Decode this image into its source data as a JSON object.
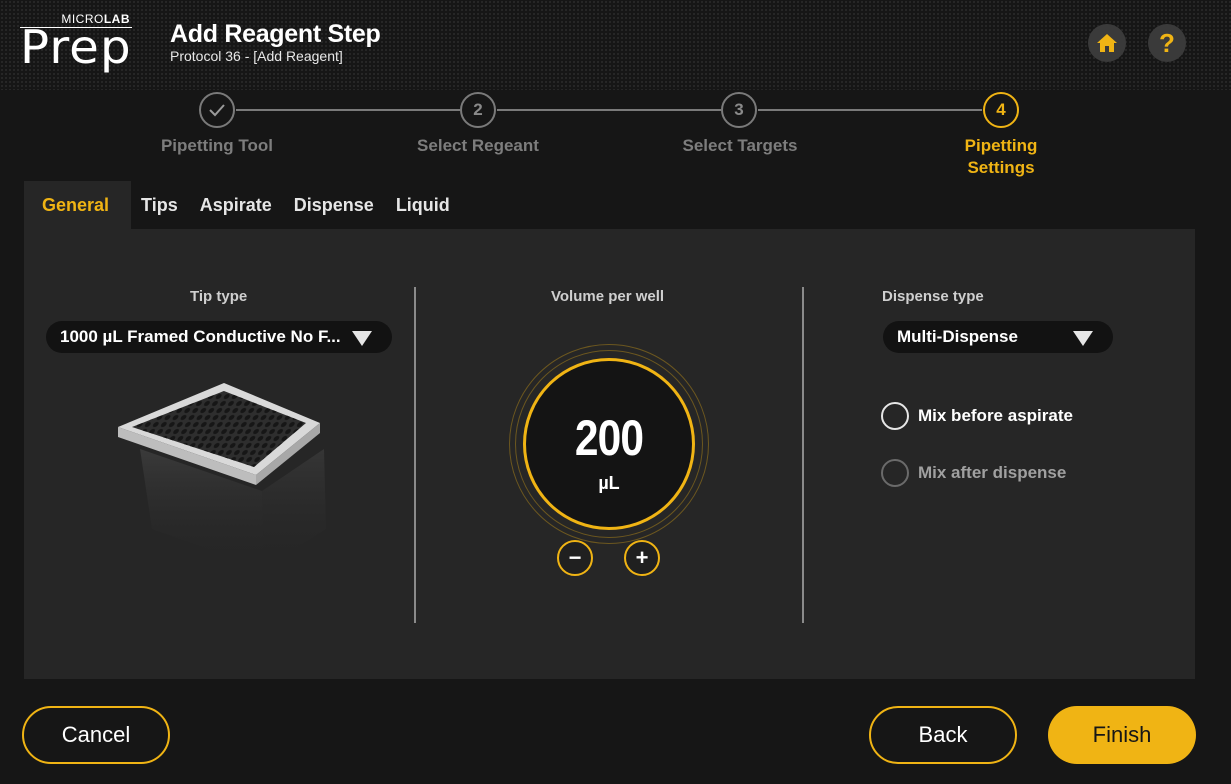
{
  "header": {
    "logo_small_prefix": "MICRO",
    "logo_small_bold": "LAB",
    "logo_big": "Prep",
    "title": "Add Reagent Step",
    "subtitle": "Protocol 36 - [Add Reagent]"
  },
  "icons": {
    "home": "home-icon",
    "help": "help-icon",
    "check": "check-icon"
  },
  "header_buttons": {
    "help_glyph": "?"
  },
  "stepper": {
    "steps": [
      {
        "number": "",
        "label": "Pipetting Tool",
        "state": "done"
      },
      {
        "number": "2",
        "label": "Select Regeant",
        "state": "pending"
      },
      {
        "number": "3",
        "label": "Select Targets",
        "state": "pending"
      },
      {
        "number": "4",
        "label": "Pipetting Settings",
        "state": "active"
      }
    ]
  },
  "tabs": [
    {
      "label": "General",
      "active": true
    },
    {
      "label": "Tips",
      "active": false
    },
    {
      "label": "Aspirate",
      "active": false
    },
    {
      "label": "Dispense",
      "active": false
    },
    {
      "label": "Liquid",
      "active": false
    }
  ],
  "general": {
    "tip_type": {
      "label": "Tip type",
      "value": "1000 µL Framed Conductive No F..."
    },
    "volume": {
      "label": "Volume per well",
      "value": "200",
      "unit": "µL",
      "minus": "−",
      "plus": "+"
    },
    "dispense_type": {
      "label": "Dispense type",
      "value": "Multi-Dispense"
    },
    "options": [
      {
        "label": "Mix before aspirate",
        "checked": false,
        "enabled": true
      },
      {
        "label": "Mix after dispense",
        "checked": false,
        "enabled": false
      }
    ]
  },
  "footer": {
    "cancel": "Cancel",
    "back": "Back",
    "finish": "Finish"
  },
  "colors": {
    "accent": "#f0b414",
    "background": "#161616",
    "panel": "#262626"
  }
}
